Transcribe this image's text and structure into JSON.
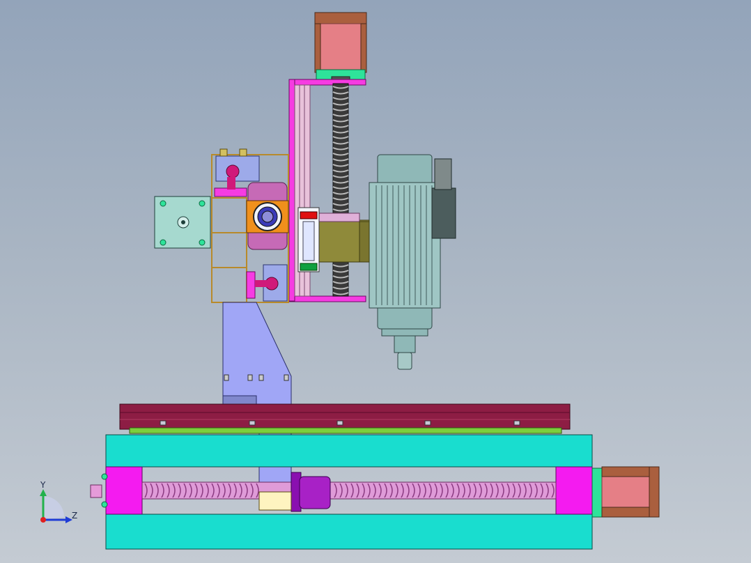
{
  "triad": {
    "y_label": "Y",
    "z_label": "Z",
    "y_axis_color": "#22b14c",
    "z_axis_color": "#1f3cd6",
    "x_axis_color": "#e02020"
  },
  "colors": {
    "motor_body": "#e57f86",
    "motor_flange": "#aa5f3e",
    "motor_base_green": "#2ee39a",
    "base_frame": "#19ddcf",
    "rail": "#8d1d44",
    "ball_screw": "#df9bd8",
    "end_block": "#f41bf0",
    "gantry_arm": "#a0a6f6",
    "spindle": "#8fb8b7",
    "z_plate": "#f63ce2",
    "carriage": "#8f8a3a",
    "stepper": "#a6d9cf",
    "bearing_pillow": "#9daae9"
  }
}
